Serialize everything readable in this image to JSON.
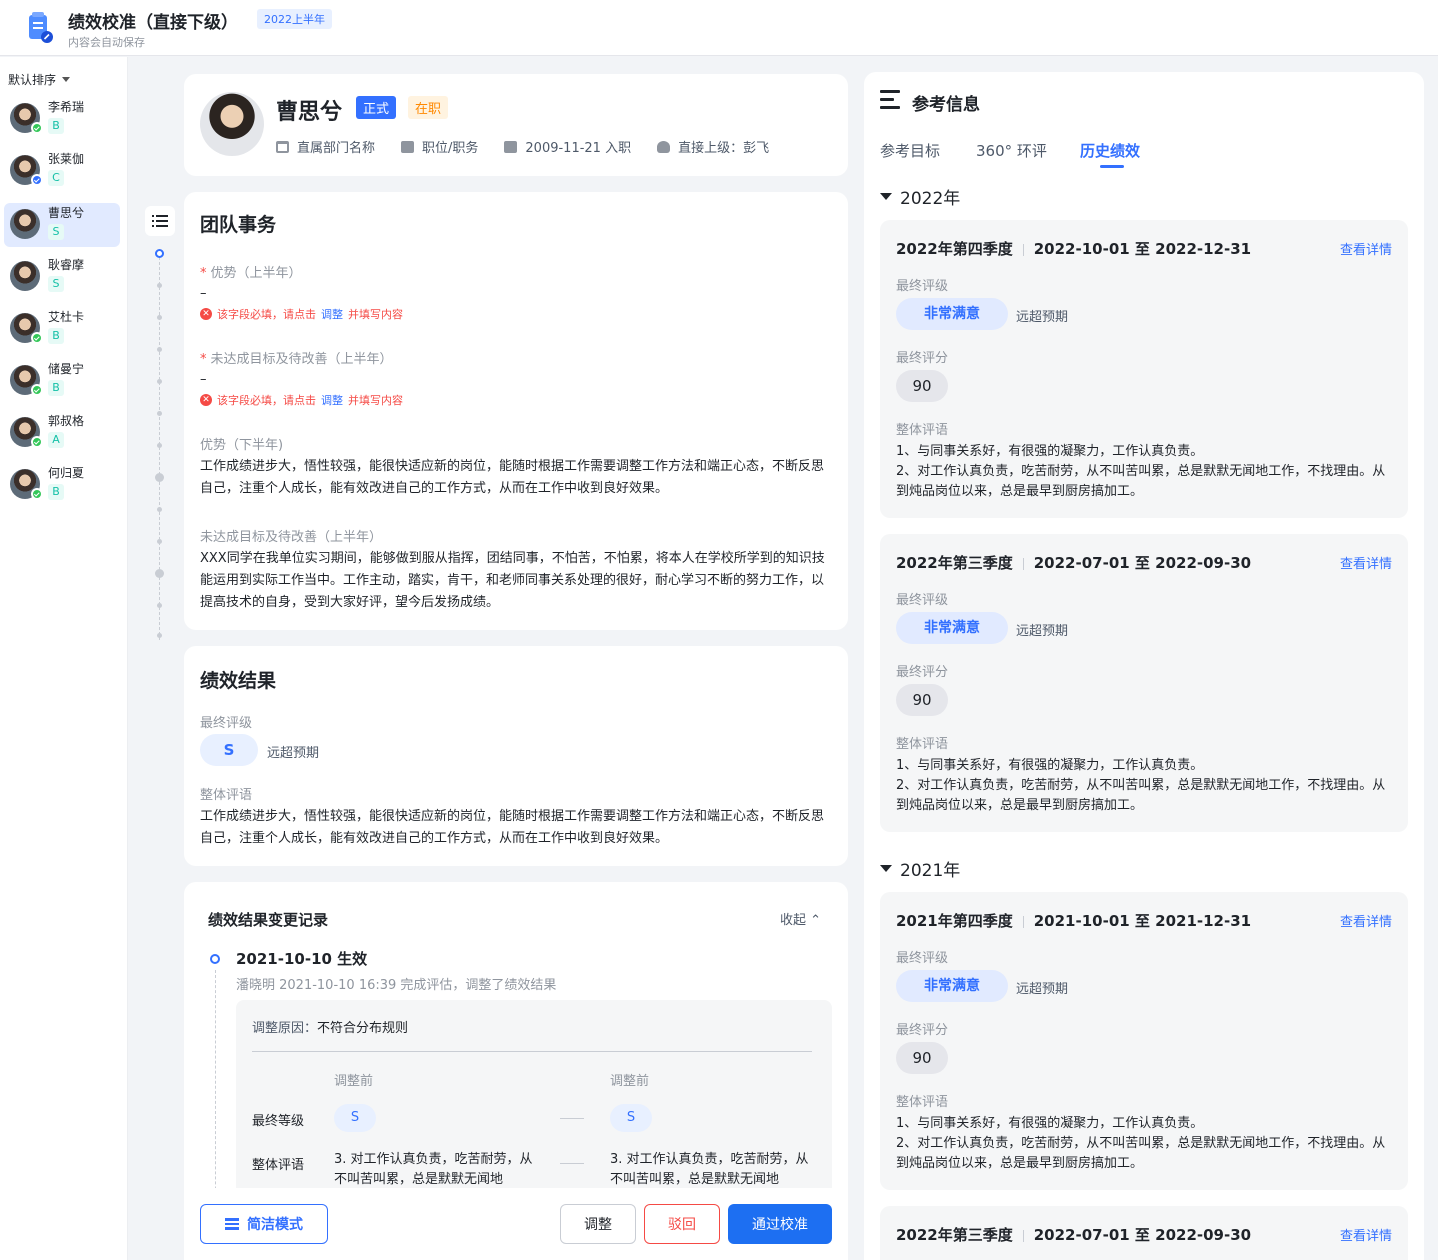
{
  "header": {
    "title": "绩效校准（直接下级）",
    "period": "2022上半年",
    "autosave": "内容会自动保存"
  },
  "sidebar": {
    "sort_label": "默认排序",
    "people": [
      {
        "name": "李希瑞",
        "grade": "B",
        "status": "done"
      },
      {
        "name": "张莱伽",
        "grade": "C",
        "status": "pending"
      },
      {
        "name": "曹思兮",
        "grade": "S",
        "status": "none"
      },
      {
        "name": "耿睿摩",
        "grade": "S",
        "status": "none"
      },
      {
        "name": "艾杜卡",
        "grade": "B",
        "status": "done"
      },
      {
        "name": "储曼宁",
        "grade": "B",
        "status": "done"
      },
      {
        "name": "郭叔格",
        "grade": "A",
        "status": "done"
      },
      {
        "name": "何归夏",
        "grade": "B",
        "status": "done"
      }
    ]
  },
  "profile": {
    "name": "曹思兮",
    "tag_type": "正式",
    "tag_status": "在职",
    "department": "直属部门名称",
    "position": "职位/职务",
    "join_date": "2009-11-21 入职",
    "manager": "直接上级：彭飞"
  },
  "team": {
    "title": "团队事务",
    "field1_label": "优势（上半年）",
    "field1_value": "–",
    "field2_label": "未达成目标及待改善（上半年）",
    "field2_value": "–",
    "err_prefix": "该字段必填，请点击",
    "err_link": "调整",
    "err_suffix": "并填写内容",
    "field3_label": "优势（下半年)",
    "field3_text": "工作成绩进步大，悟性较强，能很快适应新的岗位，能随时根据工作需要调整工作方法和端正心态，不断反思自己，注重个人成长，能有效改进自己的工作方式，从而在工作中收到良好效果。",
    "field4_label": "未达成目标及待改善（上半年）",
    "field4_text": "XXX同学在我单位实习期间，能够做到服从指挥，团结同事，不怕苦，不怕累，将本人在学校所学到的知识技能运用到实际工作当中。工作主动，踏实，肯干，和老师同事关系处理的很好，耐心学习不断的努力工作，以提高技术的自身，受到大家好评，望今后发扬成绩。"
  },
  "result": {
    "title": "绩效结果",
    "grade_label": "最终评级",
    "grade": "S",
    "grade_note": "远超预期",
    "comment_label": "整体评语",
    "comment": "工作成绩进步大，悟性较强，能很快适应新的岗位，能随时根据工作需要调整工作方法和端正心态，不断反思自己，注重个人成长，能有效改进自己的工作方式，从而在工作中收到良好效果。"
  },
  "changelog": {
    "title": "绩效结果变更记录",
    "collapse": "收起",
    "date": "2021-10-10 生效",
    "sub": "潘晓明 2021-10-10 16:39 完成评估，调整了绩效结果",
    "reason_label": "调整原因：",
    "reason": "不符合分布规则",
    "col_before": "调整前",
    "col_after": "调整前",
    "row1_label": "最终等级",
    "row1_before": "S",
    "row1_after": "S",
    "row2_label": "整体评语",
    "row2_before": "3. 对工作认真负责，吃苦耐劳，从不叫苦叫累，总是默默无闻地",
    "row2_after": "3. 对工作认真负责，吃苦耐劳，从不叫苦叫累，总是默默无闻地"
  },
  "footer": {
    "simple_mode": "简洁模式",
    "adjust": "调整",
    "reject": "驳回",
    "approve": "通过校准"
  },
  "reference": {
    "title": "参考信息",
    "tabs": [
      "参考目标",
      "360° 环评",
      "历史绩效"
    ],
    "active_tab": 2,
    "detail_label": "查看详情",
    "grade_label": "最终评级",
    "score_label": "最终评分",
    "comment_label": "整体评语",
    "years": [
      {
        "year": "2022年",
        "quarters": [
          {
            "name": "2022年第四季度",
            "range": "2022-10-01 至 2022-12-31",
            "grade": "非常满意",
            "note": "远超预期",
            "score": "90",
            "comment": "1、与同事关系好，有很强的凝聚力，工作认真负责。\n2、对工作认真负责，吃苦耐劳，从不叫苦叫累，总是默默无闻地工作，不找理由。从到炖品岗位以来，总是最早到厨房搞加工。"
          },
          {
            "name": "2022年第三季度",
            "range": "2022-07-01 至 2022-09-30",
            "grade": "非常满意",
            "note": "远超预期",
            "score": "90",
            "comment": "1、与同事关系好，有很强的凝聚力，工作认真负责。\n2、对工作认真负责，吃苦耐劳，从不叫苦叫累，总是默默无闻地工作，不找理由。从到炖品岗位以来，总是最早到厨房搞加工。"
          }
        ]
      },
      {
        "year": "2021年",
        "quarters": [
          {
            "name": "2021年第四季度",
            "range": "2021-10-01 至 2021-12-31",
            "grade": "非常满意",
            "note": "远超预期",
            "score": "90",
            "comment": "1、与同事关系好，有很强的凝聚力，工作认真负责。\n2、对工作认真负责，吃苦耐劳，从不叫苦叫累，总是默默无闻地工作，不找理由。从到炖品岗位以来，总是最早到厨房搞加工。"
          },
          {
            "name": "2022年第三季度",
            "range": "2022-07-01 至 2022-09-30"
          }
        ]
      }
    ]
  }
}
